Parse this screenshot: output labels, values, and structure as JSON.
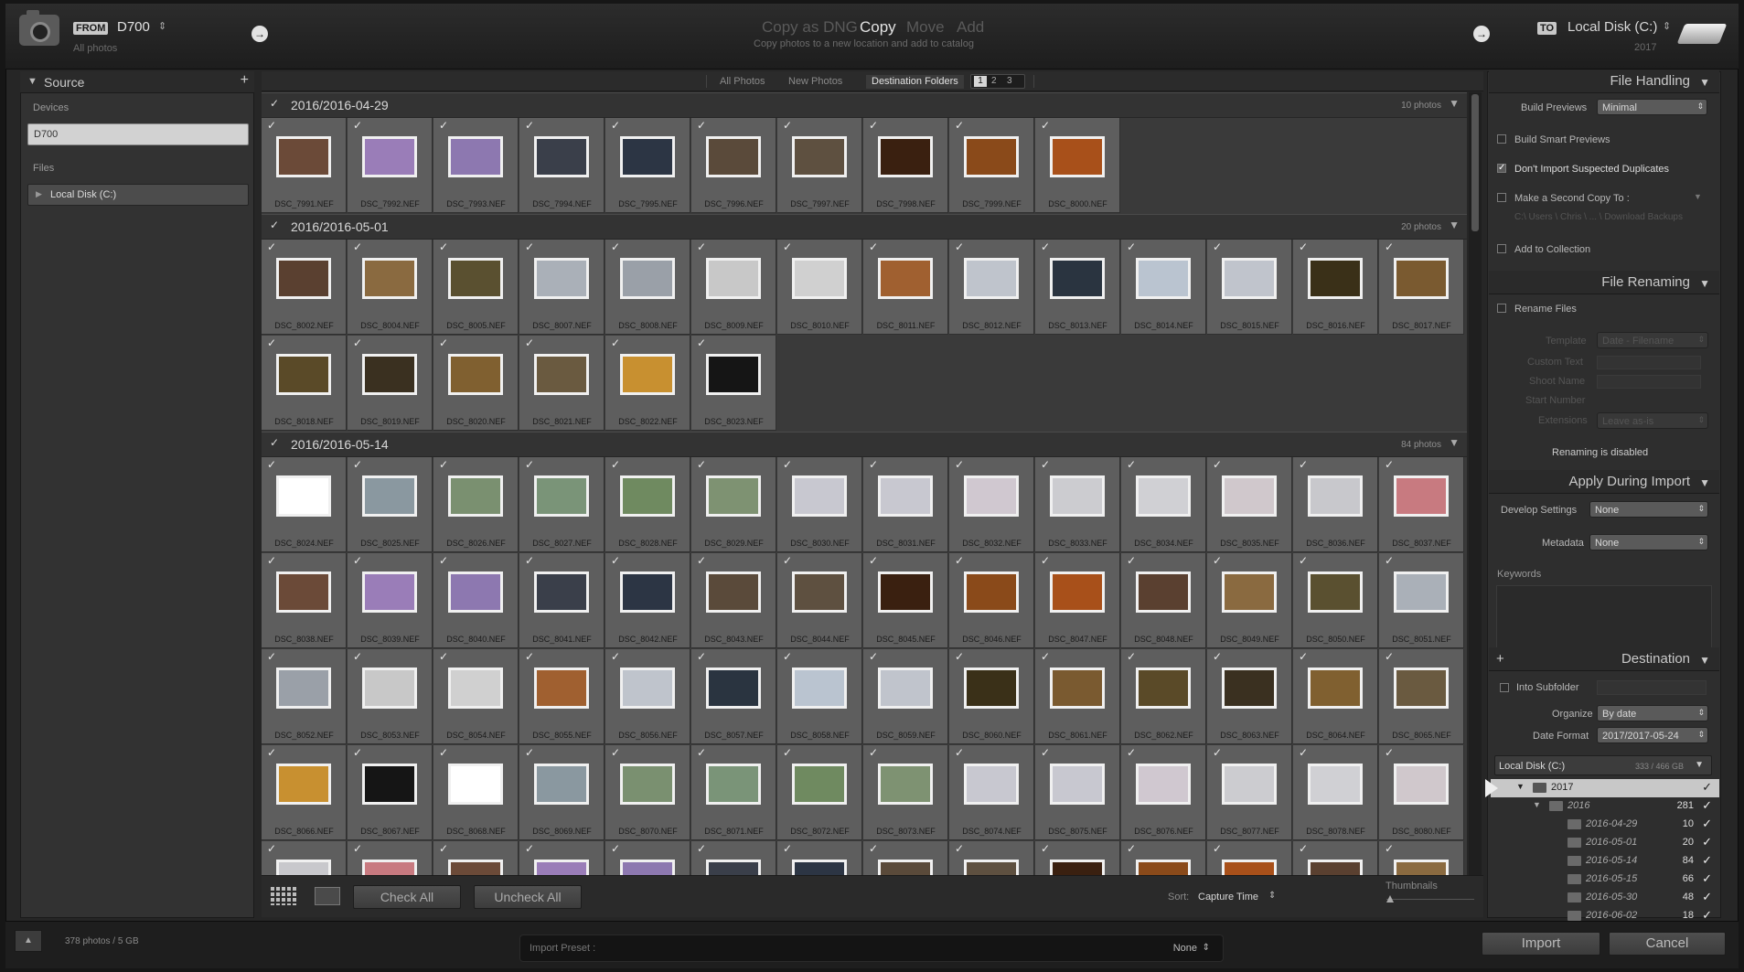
{
  "header": {
    "from_tag": "FROM",
    "source_name": "D700",
    "source_sub": "All photos",
    "modes": [
      "Copy as DNG",
      "Copy",
      "Move",
      "Add"
    ],
    "mode_desc": "Copy photos to a new location and add to catalog",
    "to_tag": "TO",
    "dest_name": "Local Disk (C:)",
    "dest_sub": "2017"
  },
  "source_panel": {
    "title": "Source",
    "devices_label": "Devices",
    "device": "D700",
    "files_label": "Files",
    "file_item": "Local Disk (C:)"
  },
  "view_tabs": [
    "All Photos",
    "New Photos",
    "Destination Folders"
  ],
  "page_nums": [
    "1",
    "2",
    "3"
  ],
  "groups": [
    {
      "title": "2016/2016-04-29",
      "count": "10 photos",
      "photos": [
        "DSC_7991.NEF",
        "DSC_7992.NEF",
        "DSC_7993.NEF",
        "DSC_7994.NEF",
        "DSC_7995.NEF",
        "DSC_7996.NEF",
        "DSC_7997.NEF",
        "DSC_7998.NEF",
        "DSC_7999.NEF",
        "DSC_8000.NEF"
      ]
    },
    {
      "title": "2016/2016-05-01",
      "count": "20 photos",
      "photos": [
        "DSC_8002.NEF",
        "DSC_8004.NEF",
        "DSC_8005.NEF",
        "DSC_8007.NEF",
        "DSC_8008.NEF",
        "DSC_8009.NEF",
        "DSC_8010.NEF",
        "DSC_8011.NEF",
        "DSC_8012.NEF",
        "DSC_8013.NEF",
        "DSC_8014.NEF",
        "DSC_8015.NEF",
        "DSC_8016.NEF",
        "DSC_8017.NEF",
        "DSC_8018.NEF",
        "DSC_8019.NEF",
        "DSC_8020.NEF",
        "DSC_8021.NEF",
        "DSC_8022.NEF",
        "DSC_8023.NEF"
      ]
    },
    {
      "title": "2016/2016-05-14",
      "count": "84 photos",
      "photos": [
        "DSC_8024.NEF",
        "DSC_8025.NEF",
        "DSC_8026.NEF",
        "DSC_8027.NEF",
        "DSC_8028.NEF",
        "DSC_8029.NEF",
        "DSC_8030.NEF",
        "DSC_8031.NEF",
        "DSC_8032.NEF",
        "DSC_8033.NEF",
        "DSC_8034.NEF",
        "DSC_8035.NEF",
        "DSC_8036.NEF",
        "DSC_8037.NEF",
        "DSC_8038.NEF",
        "DSC_8039.NEF",
        "DSC_8040.NEF",
        "DSC_8041.NEF",
        "DSC_8042.NEF",
        "DSC_8043.NEF",
        "DSC_8044.NEF",
        "DSC_8045.NEF",
        "DSC_8046.NEF",
        "DSC_8047.NEF",
        "DSC_8048.NEF",
        "DSC_8049.NEF",
        "DSC_8050.NEF",
        "DSC_8051.NEF",
        "DSC_8052.NEF",
        "DSC_8053.NEF",
        "DSC_8054.NEF",
        "DSC_8055.NEF",
        "DSC_8056.NEF",
        "DSC_8057.NEF",
        "DSC_8058.NEF",
        "DSC_8059.NEF",
        "DSC_8060.NEF",
        "DSC_8061.NEF",
        "DSC_8062.NEF",
        "DSC_8063.NEF",
        "DSC_8064.NEF",
        "DSC_8065.NEF",
        "DSC_8066.NEF",
        "DSC_8067.NEF",
        "DSC_8068.NEF",
        "DSC_8069.NEF",
        "DSC_8070.NEF",
        "DSC_8071.NEF",
        "DSC_8072.NEF",
        "DSC_8073.NEF",
        "DSC_8074.NEF",
        "DSC_8075.NEF",
        "DSC_8076.NEF",
        "DSC_8077.NEF",
        "DSC_8078.NEF",
        "DSC_8080.NEF",
        "",
        "",
        "",
        "",
        "",
        "",
        "",
        "",
        "",
        "",
        "",
        "",
        "",
        ""
      ]
    }
  ],
  "thumb_colors": [
    "#6b4a38",
    "#9a7db8",
    "#8d78b0",
    "#3a3f4a",
    "#2c3544",
    "#5a4a3a",
    "#5e5040",
    "#3a2010",
    "#8a4a1a",
    "#a8501a",
    "#5a4030",
    "#8a6a40",
    "#5a5030",
    "#aab0b8",
    "#9aa0a8",
    "#c8c8c8",
    "#d0d0d0",
    "#a06030",
    "#bfc4cc",
    "#2a3440",
    "#bac4d0",
    "#c0c4cc",
    "#3a3018",
    "#7a5a30",
    "#5a4a28",
    "#3a3020",
    "#806030",
    "#6a5a40",
    "#c89030",
    "#151515",
    "#ffffff",
    "#8a98a0",
    "#7a9070",
    "#7a9478",
    "#6f8a60",
    "#7e9272",
    "#c8c8d0",
    "#c8c8d0",
    "#d0c8d0",
    "#ccccd0",
    "#d0d0d4",
    "#d0c8cc",
    "#c8c8cc",
    "#c87a80"
  ],
  "toolbar": {
    "check_all": "Check All",
    "uncheck_all": "Uncheck All",
    "sort_label": "Sort:",
    "sort_value": "Capture Time",
    "thumbnails_label": "Thumbnails"
  },
  "file_handling": {
    "title": "File Handling",
    "build_previews_label": "Build Previews",
    "build_previews_value": "Minimal",
    "smart_previews": "Build Smart Previews",
    "dont_import": "Don't Import Suspected Duplicates",
    "second_copy": "Make a Second Copy To :",
    "second_copy_path": "C:\\ Users \\ Chris \\ ... \\ Download Backups",
    "add_collection": "Add to Collection"
  },
  "file_renaming": {
    "title": "File Renaming",
    "rename_files": "Rename Files",
    "template_label": "Template",
    "template_value": "Date - Filename",
    "custom_text": "Custom Text",
    "shoot_name": "Shoot Name",
    "start_number": "Start Number",
    "extensions_label": "Extensions",
    "extensions_value": "Leave as-is",
    "disabled_note": "Renaming is disabled"
  },
  "apply_import": {
    "title": "Apply During Import",
    "develop_label": "Develop Settings",
    "develop_value": "None",
    "metadata_label": "Metadata",
    "metadata_value": "None",
    "keywords_label": "Keywords"
  },
  "destination": {
    "title": "Destination",
    "into_subfolder": "Into Subfolder",
    "organize_label": "Organize",
    "organize_value": "By date",
    "date_format_label": "Date Format",
    "date_format_value": "2017/2017-05-24",
    "disk_name": "Local Disk (C:)",
    "disk_space": "333 / 466 GB",
    "folders": [
      {
        "name": "2017",
        "count": ""
      },
      {
        "name": "2016",
        "count": "281"
      },
      {
        "name": "2016-04-29",
        "count": "10"
      },
      {
        "name": "2016-05-01",
        "count": "20"
      },
      {
        "name": "2016-05-14",
        "count": "84"
      },
      {
        "name": "2016-05-15",
        "count": "66"
      },
      {
        "name": "2016-05-30",
        "count": "48"
      },
      {
        "name": "2016-06-02",
        "count": "18"
      }
    ]
  },
  "status": {
    "photo_count": "378 photos / 5 GB",
    "import_preset_label": "Import Preset :",
    "import_preset_value": "None",
    "import_button": "Import",
    "cancel_button": "Cancel"
  }
}
